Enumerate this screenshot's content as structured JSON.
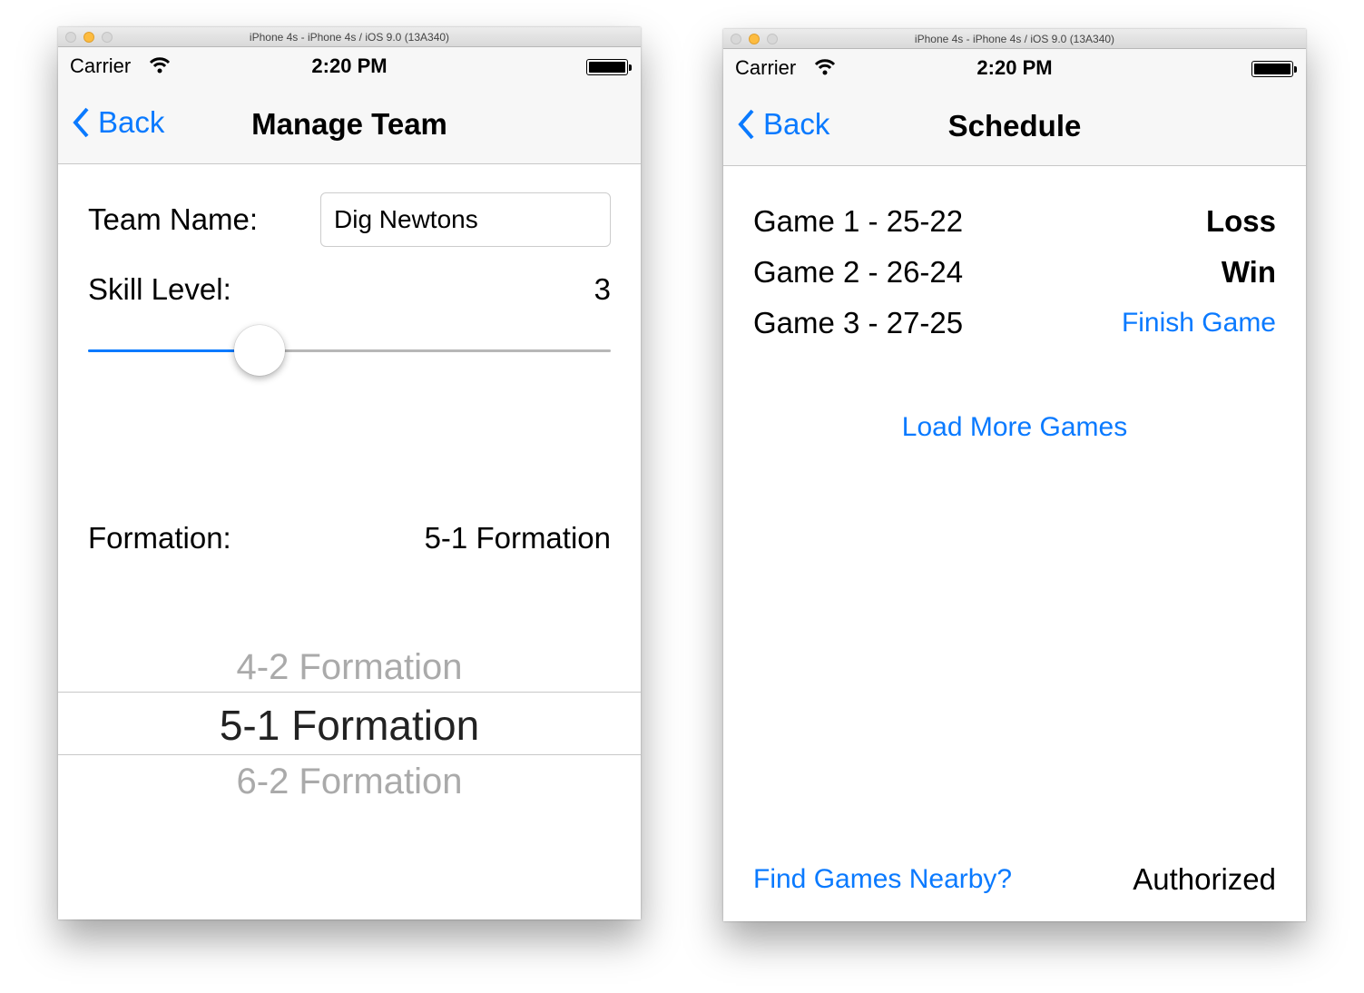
{
  "windows": [
    {
      "title": "iPhone 4s - iPhone 4s / iOS 9.0 (13A340)",
      "carrier": "Carrier",
      "time": "2:20 PM",
      "back": "Back",
      "nav_title": "Manage Team",
      "team_name_label": "Team Name:",
      "team_name_value": "Dig Newtons",
      "skill_label": "Skill Level:",
      "skill_value": "3",
      "skill_slider_fraction": 0.31,
      "formation_label": "Formation:",
      "formation_value": "5-1 Formation",
      "picker_options": [
        "4-2 Formation",
        "5-1 Formation",
        "6-2 Formation"
      ],
      "picker_selected": "5-1 Formation"
    },
    {
      "title": "iPhone 4s - iPhone 4s / iOS 9.0 (13A340)",
      "carrier": "Carrier",
      "time": "2:20 PM",
      "back": "Back",
      "nav_title": "Schedule",
      "games": [
        {
          "label": "Game 1 - 25-22",
          "result": "Loss",
          "is_action": false
        },
        {
          "label": "Game 2 - 26-24",
          "result": "Win",
          "is_action": false
        },
        {
          "label": "Game 3 - 27-25",
          "result": "Finish Game",
          "is_action": true
        }
      ],
      "load_more": "Load More Games",
      "find_nearby": "Find Games Nearby?",
      "auth_status": "Authorized"
    }
  ],
  "colors": {
    "accent": "#0a7aff",
    "picker_inactive": "#aaaaaa"
  }
}
